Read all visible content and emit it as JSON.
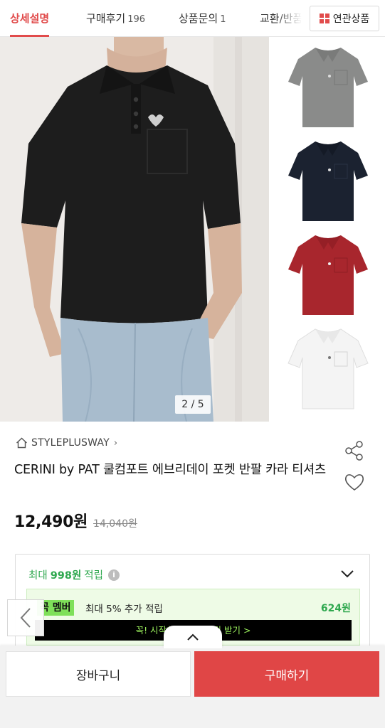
{
  "tabs": [
    {
      "label": "상세설명",
      "count": null,
      "active": true
    },
    {
      "label": "구매후기",
      "count": "196",
      "active": false
    },
    {
      "label": "상품문의",
      "count": "1",
      "active": false
    },
    {
      "label": "교환/반품",
      "count": null,
      "active": false
    }
  ],
  "related_button": {
    "label": "연관상품",
    "icon": "grid-icon"
  },
  "gallery": {
    "current": 2,
    "total": 5,
    "counter_text": "2 / 5",
    "main_shirt_color": "#1d1d1d",
    "thumbnail_colors": [
      "#8a8b8a",
      "#1b2230",
      "#a8262d",
      "#f3f3f3"
    ]
  },
  "store": {
    "name": "STYLEPLUSWAY",
    "icon": "home-icon"
  },
  "product": {
    "title": "CERINI by PAT 쿨컴포트 에브리데이 포켓 반팔 카라 티셔츠",
    "price": "12,490원",
    "original_price": "14,040원"
  },
  "points": {
    "prefix": "최대",
    "amount": "998원",
    "suffix": "적립",
    "member_badge": "꼭 멤버",
    "member_text": "최대 5% 추가 적립",
    "member_amount": "624원",
    "member_cta": "꼭! 시작하고 혜택 적립 받기 >"
  },
  "actions": {
    "cart": "장바구니",
    "buy": "구매하기"
  },
  "colors": {
    "accent": "#e14b4b",
    "buy": "#e04646",
    "green": "#2fa84f",
    "member_green": "#7fe05a"
  }
}
